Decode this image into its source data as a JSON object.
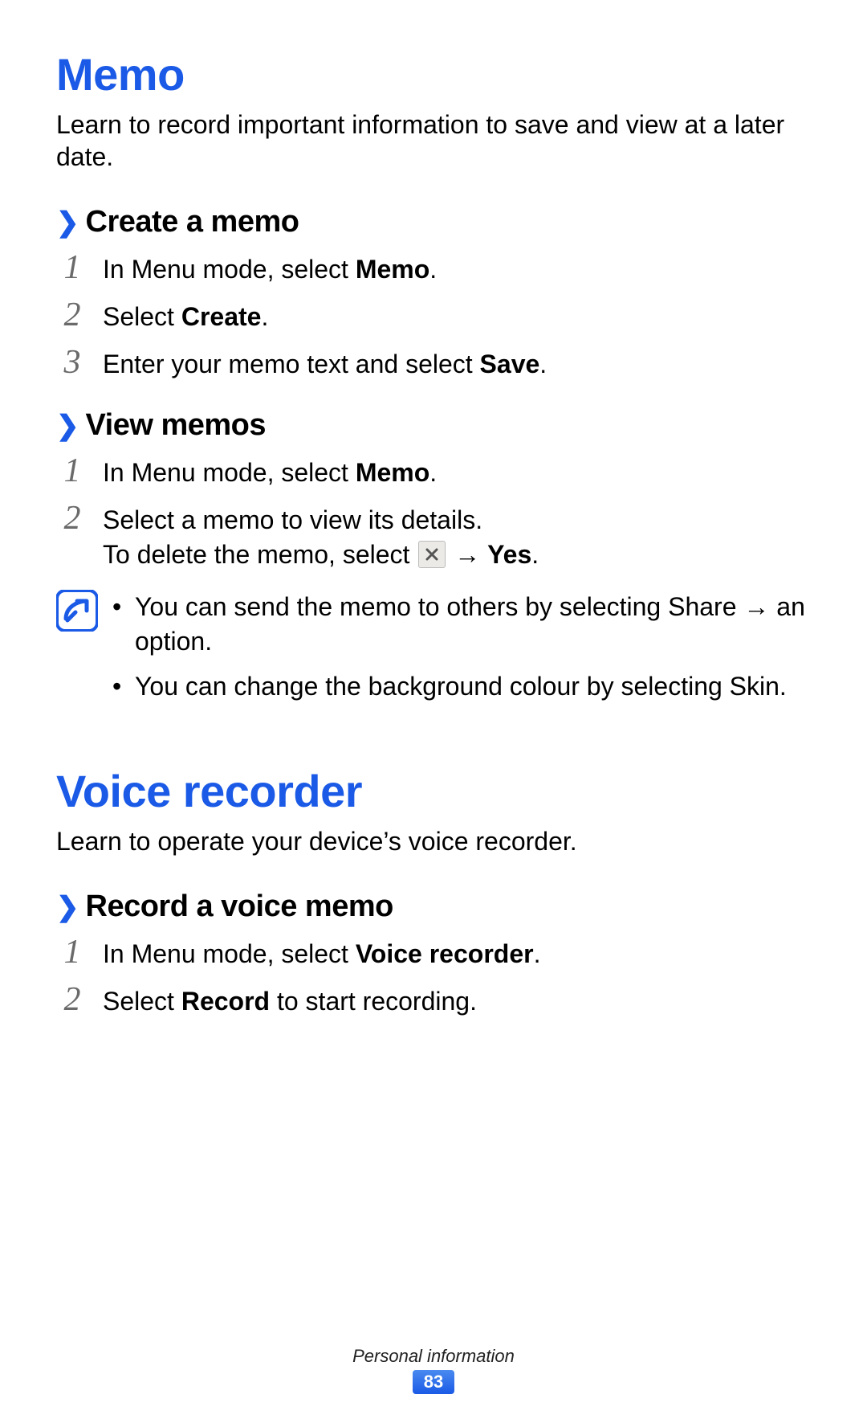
{
  "memo": {
    "title": "Memo",
    "intro": "Learn to record important information to save and view at a later date.",
    "create": {
      "heading": "Create a memo",
      "steps": {
        "s1_a": "In Menu mode, select ",
        "s1_b": "Memo",
        "s1_c": ".",
        "s2_a": "Select ",
        "s2_b": "Create",
        "s2_c": ".",
        "s3_a": "Enter your memo text and select ",
        "s3_b": "Save",
        "s3_c": "."
      }
    },
    "view": {
      "heading": "View memos",
      "steps": {
        "s1_a": "In Menu mode, select ",
        "s1_b": "Memo",
        "s1_c": ".",
        "s2_a": "Select a memo to view its details.",
        "s2_line2_a": "To delete the memo, select ",
        "s2_line2_b": " → ",
        "s2_line2_c": "Yes",
        "s2_line2_d": "."
      },
      "notes": {
        "n1_a": "You can send the memo to others by selecting ",
        "n1_b": "Share",
        "n1_c": " → an option.",
        "n2_a": "You can change the background colour by selecting ",
        "n2_b": "Skin",
        "n2_c": "."
      }
    }
  },
  "voice": {
    "title": "Voice recorder",
    "intro": "Learn to operate your device’s voice recorder.",
    "record": {
      "heading": "Record a voice memo",
      "steps": {
        "s1_a": "In Menu mode, select ",
        "s1_b": "Voice recorder",
        "s1_c": ".",
        "s2_a": "Select ",
        "s2_b": "Record",
        "s2_c": " to start recording."
      }
    }
  },
  "footer": {
    "section": "Personal information",
    "page": "83"
  },
  "nums": {
    "n1": "1",
    "n2": "2",
    "n3": "3"
  }
}
